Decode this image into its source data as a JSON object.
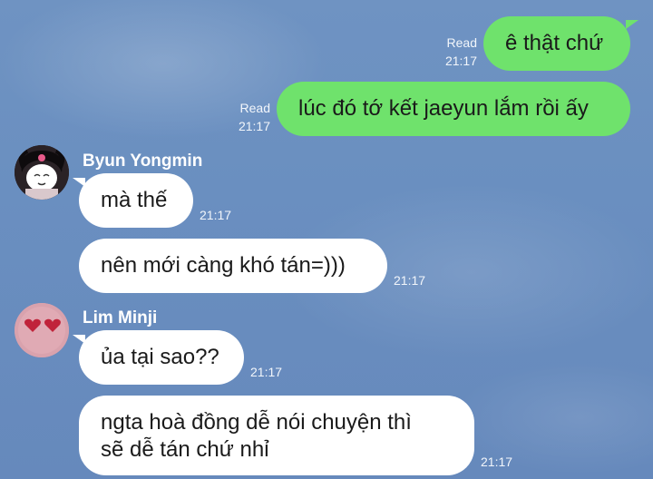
{
  "outgoing": [
    {
      "text": "ê thật chứ",
      "status": "Read",
      "time": "21:17"
    },
    {
      "text": "lúc đó tớ kết jaeyun lắm rồi ấy",
      "status": "Read",
      "time": "21:17"
    }
  ],
  "groups": [
    {
      "sender": "Byun Yongmin",
      "avatar_icon": "cartoon-character-avatar-icon",
      "messages": [
        {
          "text": "mà thế",
          "time": "21:17"
        },
        {
          "text": "nên mới càng khó tán=)))",
          "time": "21:17"
        }
      ]
    },
    {
      "sender": "Lim Minji",
      "avatar_icon": "heart-eyes-avatar-icon",
      "messages": [
        {
          "text": "ủa tại sao??",
          "time": "21:17"
        },
        {
          "line1": "ngta hoà đồng dễ nói chuyện thì",
          "line2": "sẽ dễ tán chứ nhỉ",
          "time": "21:17"
        }
      ]
    }
  ],
  "colors": {
    "outgoing_bubble": "#6fe26c",
    "incoming_bubble": "#ffffff",
    "background": "#6a8fc0"
  }
}
